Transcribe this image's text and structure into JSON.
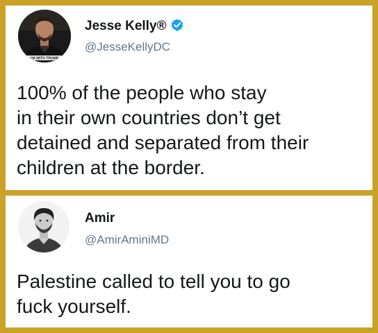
{
  "tweets": [
    {
      "name": "Jesse Kelly®",
      "handle": "@JesseKellyDC",
      "verified": true,
      "avatar_icon": "profile-photo-man-dark",
      "avatar_caption": "I'M WITH TRUMP",
      "text_lines": [
        "100% of the people who stay",
        "in their own countries don’t get",
        "detained and separated from their",
        "children at the border."
      ]
    },
    {
      "name": "Amir",
      "handle": "@AmirAminiMD",
      "verified": false,
      "avatar_icon": "profile-photo-man-bw",
      "text_lines": [
        "Palestine called to tell you to go",
        "fuck yourself."
      ]
    }
  ],
  "colors": {
    "frame": "#c9a227",
    "card_bg": "#ffffff",
    "text": "#14171a",
    "handle": "#657786",
    "verified": "#1da1f2"
  }
}
